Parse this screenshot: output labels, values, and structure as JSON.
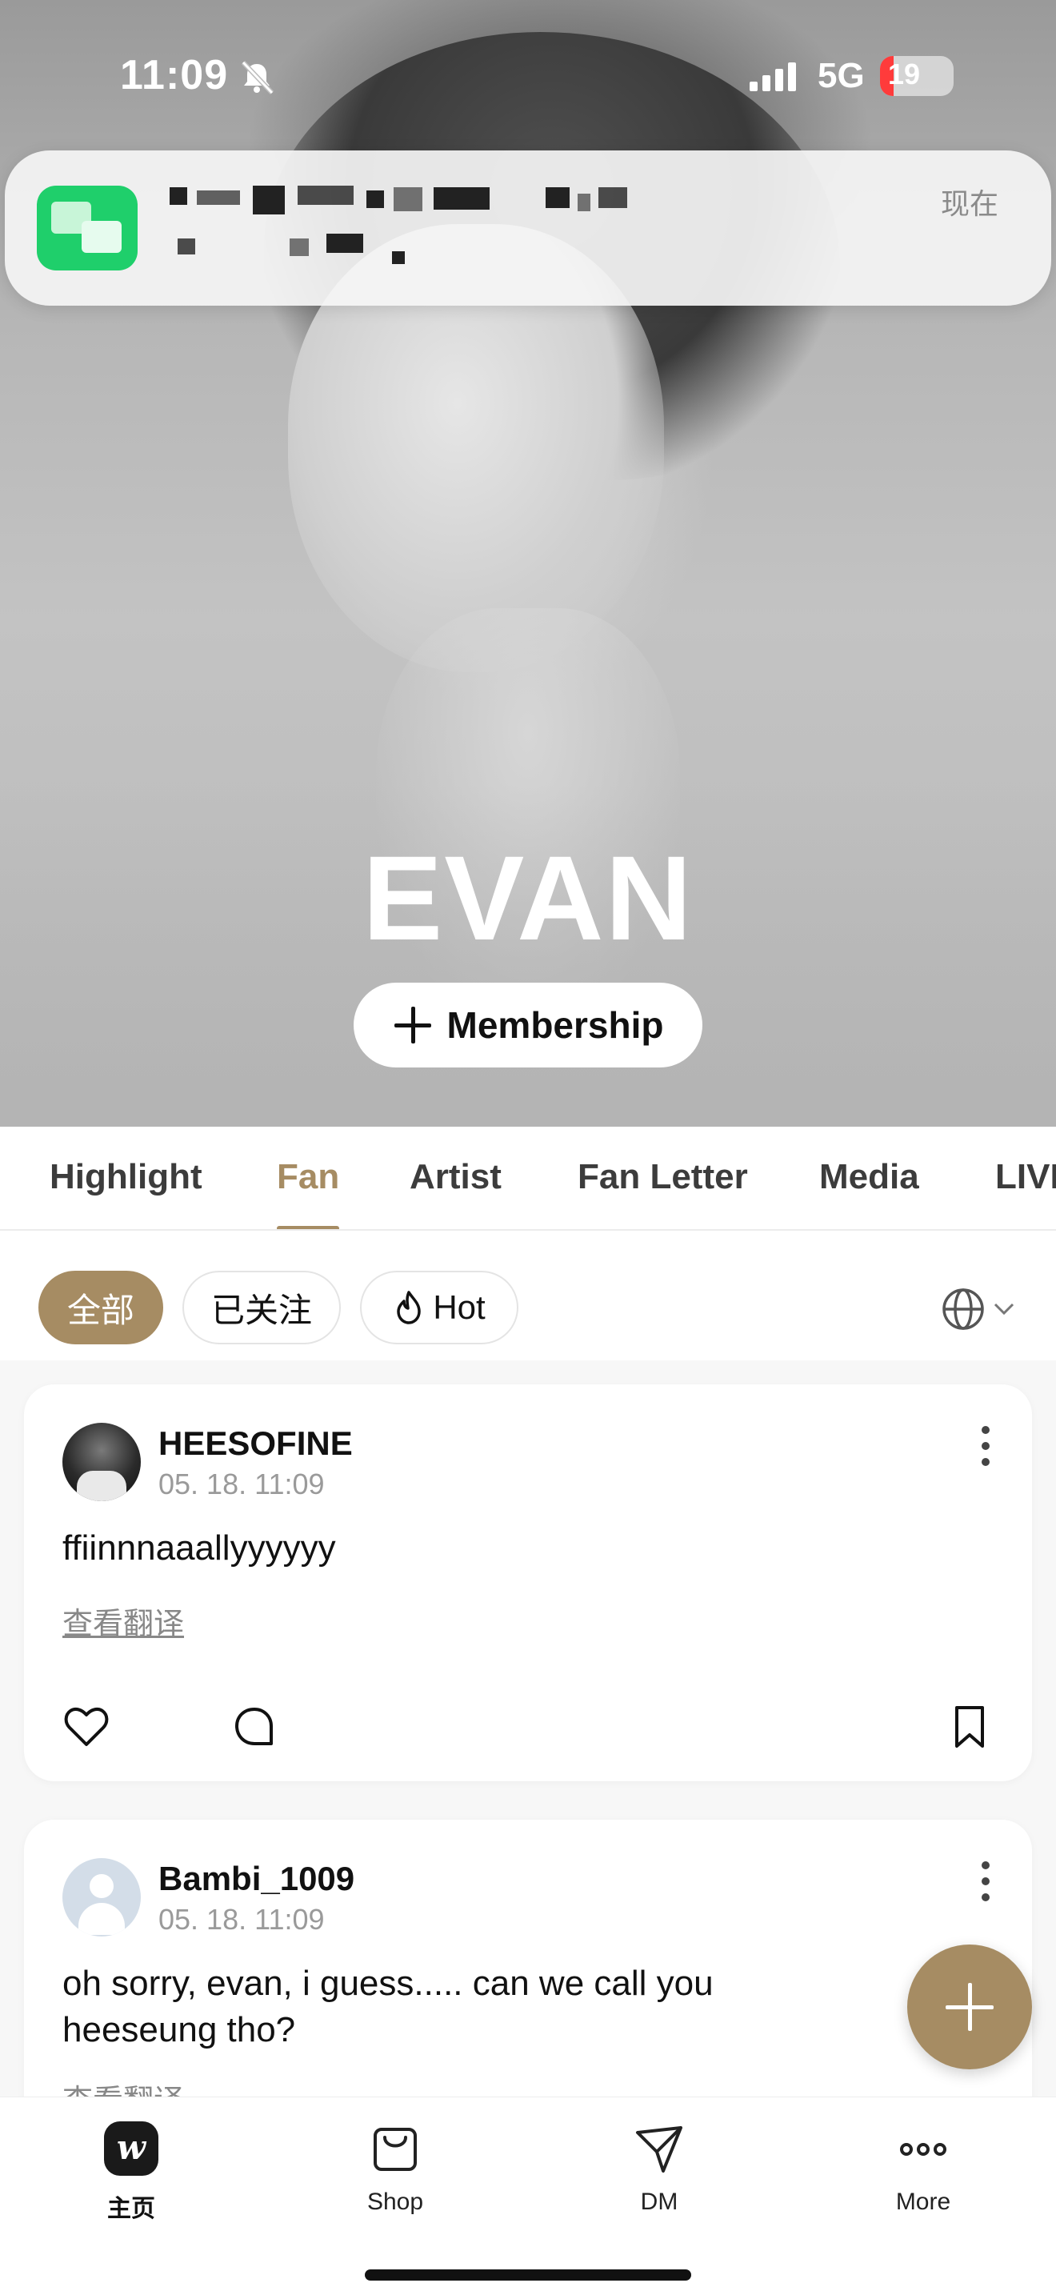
{
  "status_bar": {
    "time": "11:09",
    "network": "5G",
    "battery_text": "19",
    "battery_level": 0.19,
    "battery_color": "#ff3b3b"
  },
  "notification": {
    "time_label": "现在",
    "app_icon": "green-app-icon"
  },
  "profile": {
    "name": "EVAN",
    "membership_label": "Membership"
  },
  "tabs": [
    {
      "label": "Highlight",
      "active": false
    },
    {
      "label": "Fan",
      "active": true
    },
    {
      "label": "Artist",
      "active": false
    },
    {
      "label": "Fan Letter",
      "active": false
    },
    {
      "label": "Media",
      "active": false
    },
    {
      "label": "LIVE",
      "active": false
    }
  ],
  "filters": {
    "chips": [
      {
        "label": "全部",
        "active": true
      },
      {
        "label": "已关注",
        "active": false
      },
      {
        "label": "Hot",
        "active": false,
        "icon": "flame-icon"
      }
    ],
    "language_icon": "globe-icon"
  },
  "posts": [
    {
      "username": "HEESOFINE",
      "timestamp": "05. 18. 11:09",
      "text": "ffiinnnaaallyyyyyy",
      "translate_label": "查看翻译"
    },
    {
      "username": "Bambi_1009",
      "timestamp": "05. 18. 11:09",
      "text": "oh sorry, evan,  i guess..... can we call you heeseung tho?",
      "translate_label": "查看翻译"
    }
  ],
  "bottom_nav": [
    {
      "label": "主页",
      "icon": "home-icon",
      "active": true
    },
    {
      "label": "Shop",
      "icon": "shop-bag-icon",
      "active": false
    },
    {
      "label": "DM",
      "icon": "send-icon",
      "active": false
    },
    {
      "label": "More",
      "icon": "more-dots-icon",
      "active": false
    }
  ],
  "colors": {
    "accent": "#a68c63",
    "text": "#111111",
    "muted": "#9a9a9a"
  }
}
